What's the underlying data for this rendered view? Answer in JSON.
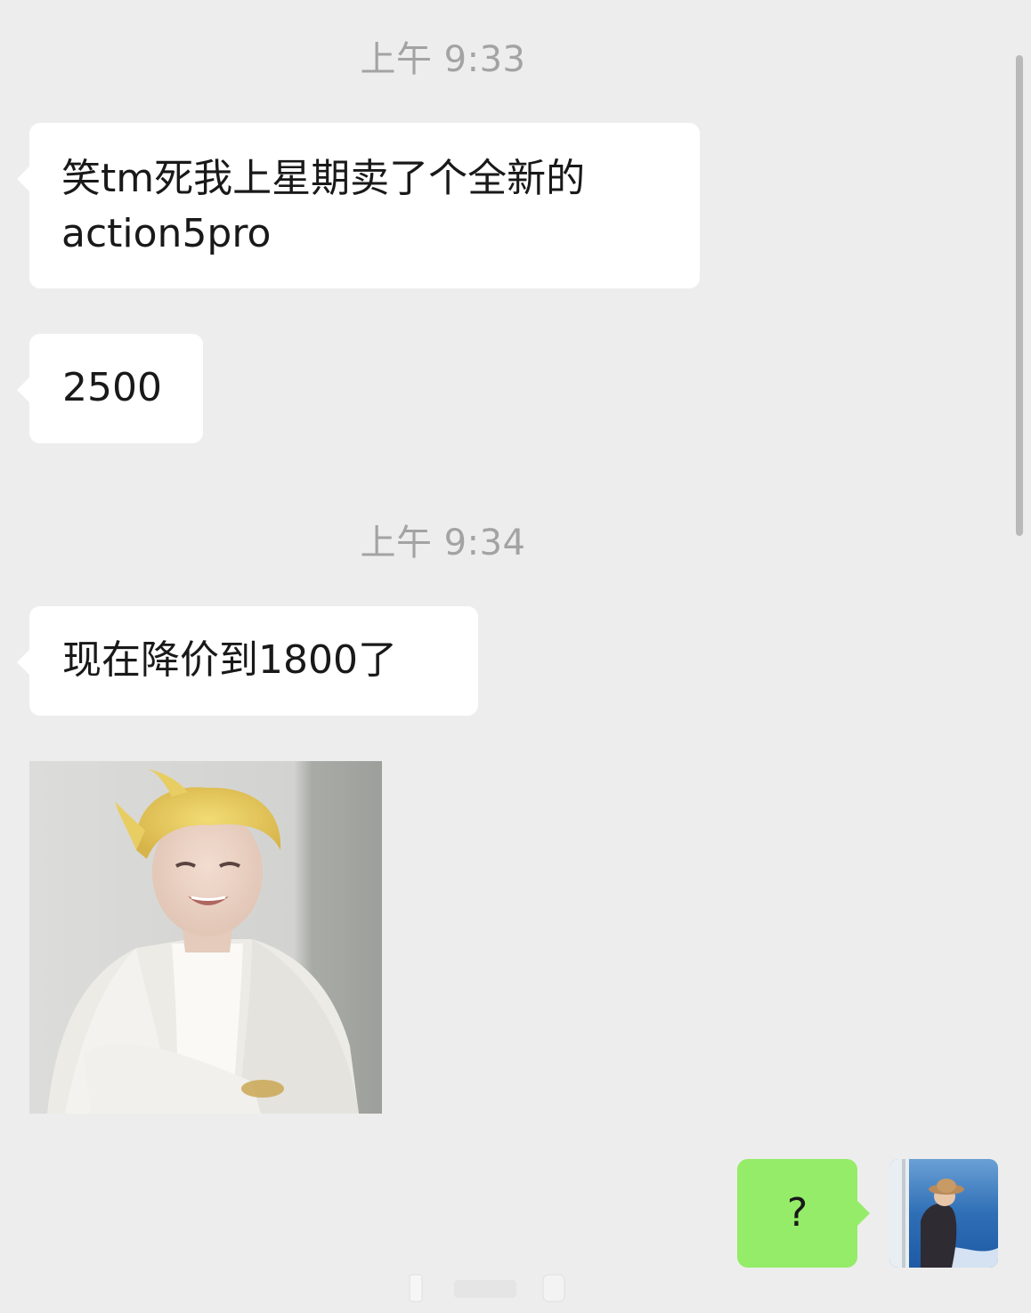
{
  "chat": {
    "timestamps": [
      "上午 9:33",
      "上午 9:34"
    ],
    "messages": {
      "m1_line1": "笑tm死我上星期卖了个全新的",
      "m1_line2": "action5pro",
      "m2": "2500",
      "m3": "现在降价到1800了",
      "m4": "?"
    }
  },
  "colors": {
    "background": "#ededed",
    "incoming_bubble": "#ffffff",
    "outgoing_bubble": "#95ec69",
    "timestamp_text": "#a3a3a3"
  }
}
